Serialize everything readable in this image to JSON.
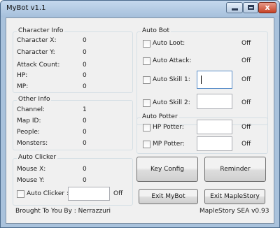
{
  "window": {
    "title": "MyBot v1.1",
    "close_glyph": "x",
    "icons": [
      "minimize-icon",
      "maximize-icon",
      "close-icon"
    ]
  },
  "character_info": {
    "title": "Character Info",
    "rows": [
      {
        "label": "Character X:",
        "value": "0"
      },
      {
        "label": "Character Y:",
        "value": "0"
      },
      {
        "label": "Attack Count:",
        "value": "0"
      },
      {
        "label": "HP:",
        "value": "0"
      },
      {
        "label": "MP:",
        "value": "0"
      }
    ]
  },
  "other_info": {
    "title": "Other Info",
    "rows": [
      {
        "label": "Channel:",
        "value": "1"
      },
      {
        "label": "Map ID:",
        "value": "0"
      },
      {
        "label": "People:",
        "value": "0"
      },
      {
        "label": "Monsters:",
        "value": "0"
      }
    ]
  },
  "auto_clicker": {
    "title": "Auto Clicker",
    "rows": [
      {
        "label": "Mouse X:",
        "value": "0"
      },
      {
        "label": "Mouse Y:",
        "value": "0"
      }
    ],
    "checkbox_label": "Auto Clicker :",
    "input_value": "",
    "status": "Off"
  },
  "auto_bot": {
    "title": "Auto Bot",
    "items": [
      {
        "label": "Auto Loot:",
        "status": "Off"
      },
      {
        "label": "Auto Attack:",
        "status": "Off"
      },
      {
        "label": "Auto Skill 1:",
        "input_value": "",
        "status": "Off"
      },
      {
        "label": "Auto Skill 2:",
        "input_value": "",
        "status": "Off"
      }
    ]
  },
  "auto_potter": {
    "title": "Auto Potter",
    "items": [
      {
        "label": "HP Potter:",
        "input_value": "",
        "status": "Off"
      },
      {
        "label": "MP Potter:",
        "input_value": "",
        "status": "Off"
      }
    ]
  },
  "buttons": {
    "key_config": "Key Config",
    "reminder": "Reminder",
    "exit_mybot": "Exit MyBot",
    "exit_maplestory": "Exit MapleStory"
  },
  "footer": {
    "credit": "Brought To You By : Nerrazzuri",
    "version": "MapleStory SEA v0.93"
  }
}
